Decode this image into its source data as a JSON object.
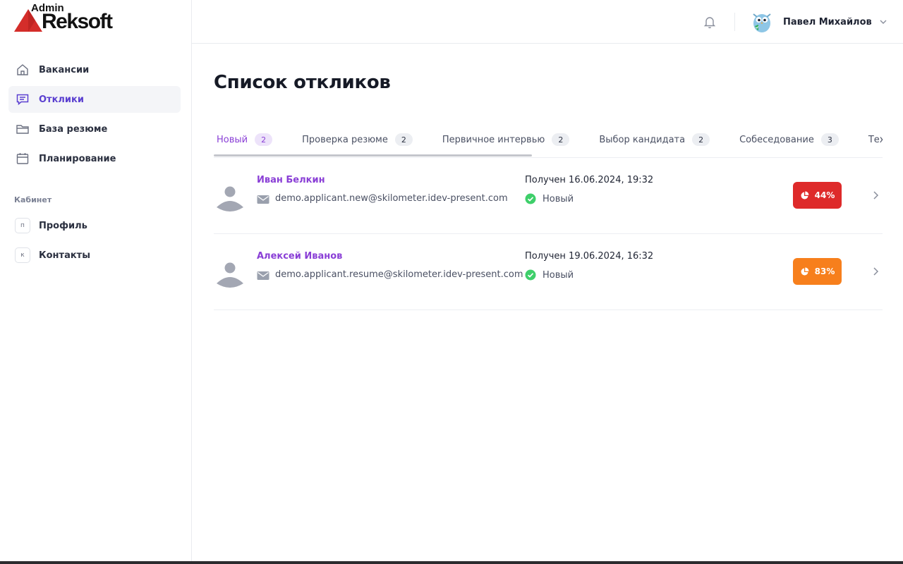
{
  "brand": {
    "admin": "Admin",
    "name": "Reksoft",
    "accent": "#d42d2a"
  },
  "sidebar": {
    "items": [
      {
        "label": "Вакансии",
        "icon": "home-icon",
        "active": false
      },
      {
        "label": "Отклики",
        "icon": "chat-icon",
        "active": true
      },
      {
        "label": "База резюме",
        "icon": "folder-icon",
        "active": false
      },
      {
        "label": "Планирование",
        "icon": "calendar-icon",
        "active": false
      }
    ],
    "section_label": "Кабинет",
    "cabinet_items": [
      {
        "letter": "п",
        "label": "Профиль"
      },
      {
        "letter": "к",
        "label": "Контакты"
      }
    ]
  },
  "header": {
    "user_name": "Павел Михайлов",
    "icons": [
      "bell-icon",
      "owl-avatar-icon",
      "chevron-down-icon"
    ]
  },
  "main": {
    "title": "Список откликов",
    "tabs": [
      {
        "label": "Новый",
        "count": "2",
        "active": true
      },
      {
        "label": "Проверка резюме",
        "count": "2",
        "active": false
      },
      {
        "label": "Первичное интервью",
        "count": "2",
        "active": false
      },
      {
        "label": "Выбор кандидата",
        "count": "2",
        "active": false
      },
      {
        "label": "Собеседование",
        "count": "3",
        "active": false
      },
      {
        "label": "Техниче",
        "count": "",
        "active": false
      }
    ],
    "responses": [
      {
        "name": "Иван Белкин",
        "email": "demo.applicant.new@skilometer.idev-present.com",
        "received": "Получен 16.06.2024, 19:32",
        "status": "Новый",
        "score": "44%",
        "score_color": "#de2a2a"
      },
      {
        "name": "Алексей Иванов",
        "email": "demo.applicant.resume@skilometer.idev-present.com",
        "received": "Получен 19.06.2024, 16:32",
        "status": "Новый",
        "score": "83%",
        "score_color": "#f77f1c"
      }
    ]
  },
  "colors": {
    "accent": "#8a3fd6",
    "status_ok": "#3ecf6a"
  }
}
